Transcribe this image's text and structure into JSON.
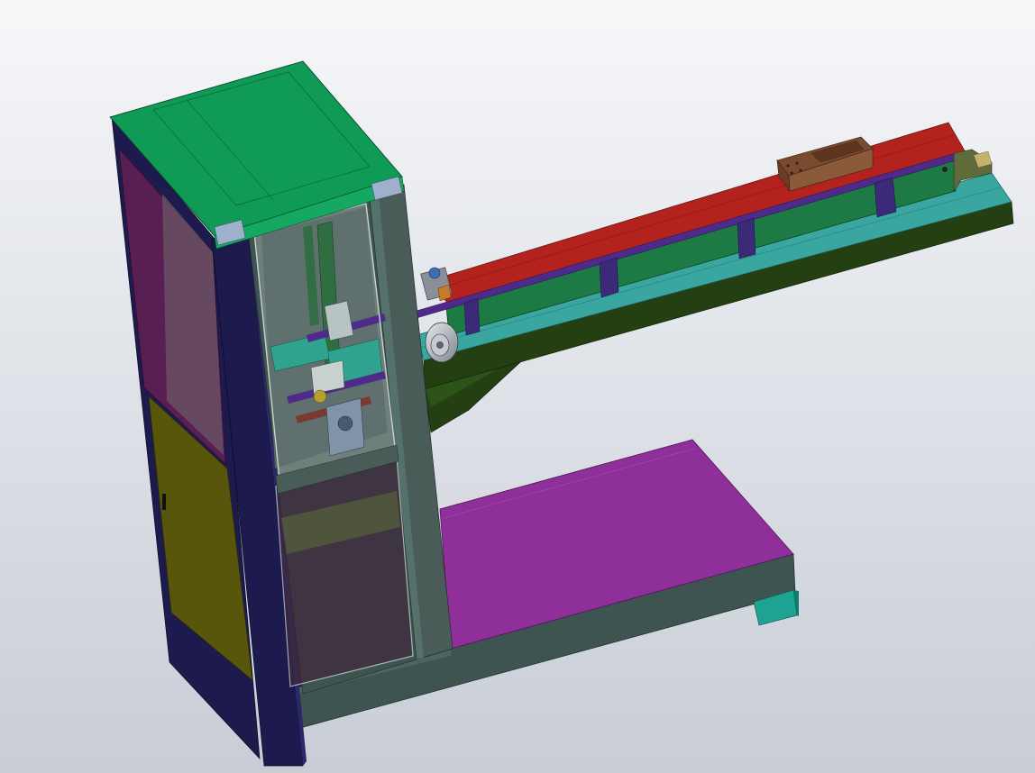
{
  "scene": {
    "type": "cad-3d-model-viewport",
    "colors": {
      "background_top": "#f6f7f9",
      "background_bottom": "#c8cdd6",
      "cabinet_top": "#0f9a55",
      "cabinet_post": "#1d1b4e",
      "cabinet_side_door": "#58560a",
      "cabinet_inner_purple": "#5a1f52",
      "window_frame": "#3e5450",
      "window_glass": "#6f7f7c",
      "green_column": "#2e6e40",
      "teal_plate": "#2fa38f",
      "base_beam": "#3e5450",
      "magenta_platform": "#8e2f9a",
      "teal_foot": "#1ea292",
      "arm_green_plate": "#1e7a45",
      "arm_teal_deck": "#3aa6a0",
      "arm_red_top": "#b3221d",
      "arm_dark_green": "#243f12",
      "arm_purple_rail": "#4e2a8a",
      "arm_brown_block": "#8a5a3a",
      "motor_gray": "#9aa0a8"
    },
    "components": [
      "cabinet-frame",
      "cabinet-top-cover",
      "cabinet-front-window",
      "cabinet-lower-window",
      "side-door",
      "base-beam",
      "platform-plate",
      "support-foot",
      "conveyor-arm",
      "arm-top-rail",
      "arm-side-plate",
      "arm-slider-block",
      "drive-motor",
      "arm-support-bracket"
    ]
  }
}
